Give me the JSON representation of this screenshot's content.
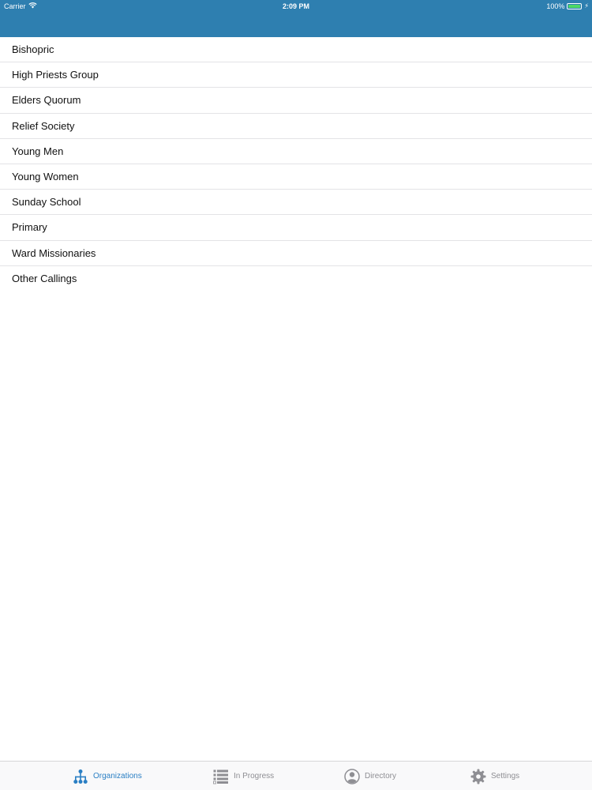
{
  "status_bar": {
    "carrier": "Carrier",
    "time": "2:09 PM",
    "battery": "100%",
    "battery_color": "#4cd964"
  },
  "header": {
    "background": "#2e7fb0"
  },
  "organizations": [
    {
      "label": "Bishopric"
    },
    {
      "label": "High Priests Group"
    },
    {
      "label": "Elders Quorum"
    },
    {
      "label": "Relief Society"
    },
    {
      "label": "Young Men"
    },
    {
      "label": "Young Women"
    },
    {
      "label": "Sunday School"
    },
    {
      "label": "Primary"
    },
    {
      "label": "Ward Missionaries"
    },
    {
      "label": "Other Callings"
    }
  ],
  "tab_bar": {
    "active_color": "#2a7fc4",
    "inactive_color": "#8e8e93",
    "tabs": [
      {
        "label": "Organizations",
        "icon": "org-chart-icon",
        "active": true
      },
      {
        "label": "In Progress",
        "icon": "list-icon",
        "active": false
      },
      {
        "label": "Directory",
        "icon": "person-circle-icon",
        "active": false
      },
      {
        "label": "Settings",
        "icon": "gear-icon",
        "active": false
      }
    ]
  }
}
